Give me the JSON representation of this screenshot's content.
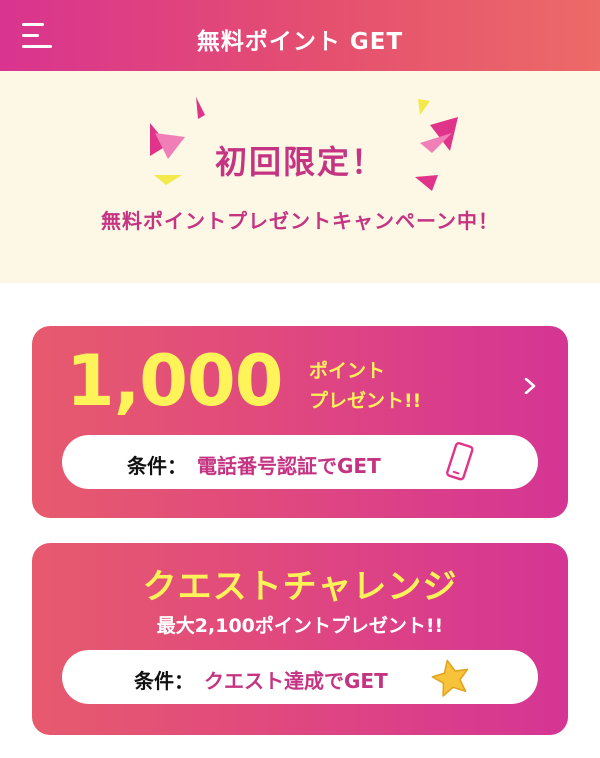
{
  "header": {
    "title": "無料ポイント GET",
    "menu_icon": "hamburger-menu-icon"
  },
  "banner": {
    "title": "初回限定！",
    "subtitle": "無料ポイントプレゼントキャンペーン中！",
    "decoration": "confetti-icon"
  },
  "phone_offer": {
    "points": "1,000",
    "label_line1": "ポイント",
    "label_line2": "プレゼント!!",
    "arrow_icon": "chevron-right-icon",
    "condition_key": "条件：",
    "condition_value": "電話番号認証でGET",
    "condition_icon": "smartphone-icon"
  },
  "quest_offer": {
    "title": "クエストチャレンジ",
    "subtitle": "最大2,100ポイントプレゼント!!",
    "condition_key": "条件：",
    "condition_value": "クエスト達成でGET",
    "condition_icon": "star-icon"
  },
  "colors": {
    "header_gradient_start": "#d9348f",
    "header_gradient_end": "#ec6a68",
    "banner_background": "#fdf7e5",
    "accent_magenta": "#c53482",
    "highlight_yellow": "#fff35a"
  }
}
